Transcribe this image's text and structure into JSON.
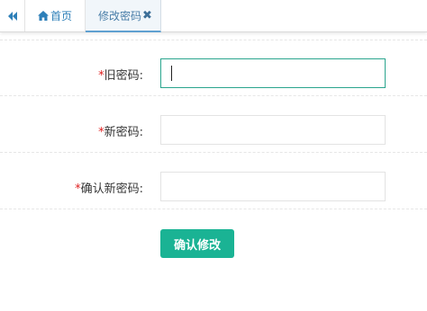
{
  "tabs": {
    "back_icon": "double-chevron-left-icon",
    "home": {
      "icon": "home-icon",
      "label": "首页"
    },
    "active": {
      "label": "修改密码",
      "close_icon": "close-icon"
    }
  },
  "form": {
    "required_mark": "*",
    "old_password": {
      "label": "旧密码:",
      "value": "",
      "focused": true
    },
    "new_password": {
      "label": "新密码:",
      "value": ""
    },
    "confirm_password": {
      "label": "确认新密码:",
      "value": ""
    },
    "submit_label": "确认修改"
  },
  "colors": {
    "accent": "#1ab394",
    "tab_text": "#2d7fb8",
    "required": "#e02020",
    "focus_border": "#2aa58e"
  }
}
